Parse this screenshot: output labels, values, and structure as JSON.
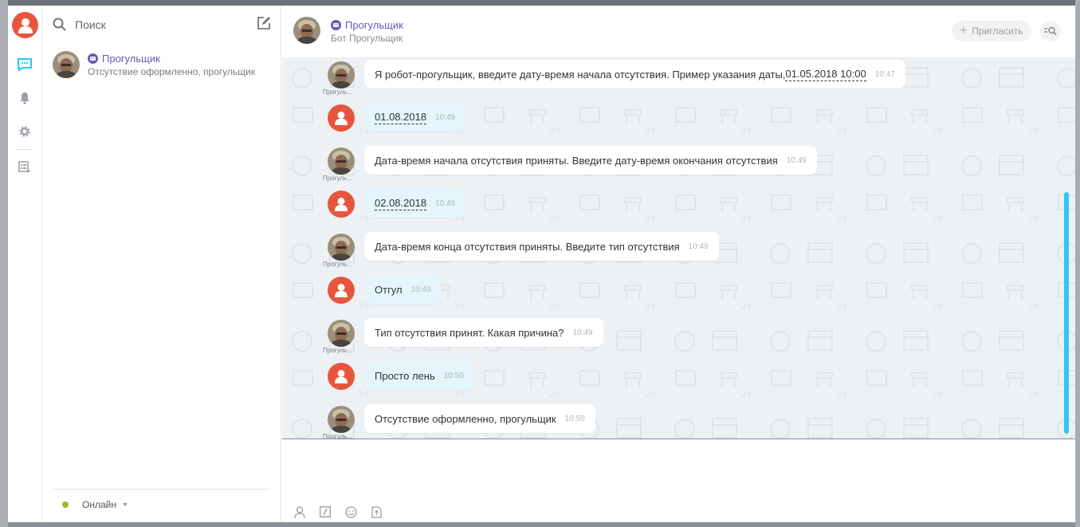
{
  "recent": {
    "search_placeholder": "Поиск",
    "items": [
      {
        "name": "Прогульщик",
        "last_message": "Отсутствие оформленно, прогульщик"
      }
    ],
    "status": "Онлайн"
  },
  "chat": {
    "title": "Прогульщик",
    "subtitle": "Бот Прогульщик",
    "invite_label": "Пригласить",
    "messages": [
      {
        "from": "bot",
        "author": "Прогуль...",
        "text": "Я  робот-прогульщик, введите дату-время начала отсутствия. Пример указания даты, ",
        "date": "01.05.2018 10:00",
        "time": "10:47"
      },
      {
        "from": "me",
        "date": "01.08.2018",
        "time": "10:49"
      },
      {
        "from": "bot",
        "author": "Прогуль...",
        "text": "Дата-время начала отсутствия приняты. Введите дату-время окончания отсутствия",
        "time": "10:49"
      },
      {
        "from": "me",
        "date": "02.08.2018",
        "time": "10:49"
      },
      {
        "from": "bot",
        "author": "Прогуль...",
        "text": "Дата-время конца отсутствия приняты. Введите тип отсутствия",
        "time": "10:49"
      },
      {
        "from": "me",
        "text": "Отгул",
        "time": "10:49"
      },
      {
        "from": "bot",
        "author": "Прогуль...",
        "text": "Тип отсутствия принят. Какая причина?",
        "time": "10:49"
      },
      {
        "from": "me",
        "text": "Просто лень",
        "time": "10:50"
      },
      {
        "from": "bot",
        "author": "Прогуль...",
        "text": "Отсутствие оформленно, прогульщик",
        "time": "10:50"
      }
    ]
  },
  "colors": {
    "accent_user": "#e8553e",
    "bot_name": "#6b56b8",
    "my_bubble": "#e4f5fd",
    "scrollbar": "#2fc6f6",
    "online": "#9dbc2a"
  },
  "icons": [
    "user-avatar-icon",
    "chat-icon",
    "bell-icon",
    "gear-icon",
    "crm-icon",
    "search-icon",
    "compose-icon",
    "bot-badge-icon",
    "plus-icon",
    "search-messages-icon",
    "mention-icon",
    "command-icon",
    "smile-icon",
    "file-icon"
  ]
}
